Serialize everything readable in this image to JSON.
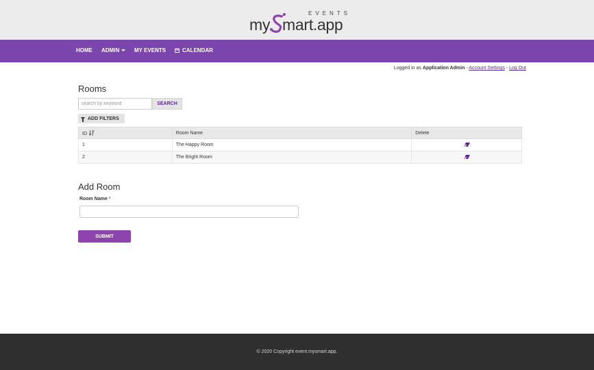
{
  "brand": {
    "logo_left": "my",
    "logo_right": "mart.app",
    "logo_sub": "EVENTS"
  },
  "nav": {
    "home": "HOME",
    "admin": "ADMIN",
    "my_events": "MY EVENTS",
    "calendar": "CALENDAR"
  },
  "user_bar": {
    "prefix": "Logged in as",
    "user": "Application Admin",
    "sep1": "-",
    "account": "Account Settings",
    "sep2": "-",
    "logout": "Log Out"
  },
  "rooms": {
    "title": "Rooms",
    "search_placeholder": "search by keyword",
    "search_label": "SEARCH",
    "filters_label": "ADD FILTERS",
    "columns": [
      "ID",
      "Room Name",
      "Delete"
    ],
    "rows": [
      {
        "id": "1",
        "name": "The Happy Room"
      },
      {
        "id": "2",
        "name": "The Bright Room"
      }
    ]
  },
  "add_room": {
    "title": "Add Room",
    "field_label": "Room Name",
    "required_mark": "*",
    "room_value": "",
    "submit_label": "SUBMIT"
  },
  "footer": {
    "copyright": "© 2020 Copyright event.mysmart.app."
  },
  "colors": {
    "nav_bg": "#7a45ac",
    "submit_bg": "#8e44ad",
    "link": "#5a2a8c",
    "footer_bg": "#2f2f2f",
    "topbar_bg": "#ececec"
  },
  "icons": {
    "sort": "sort-numeric-icon",
    "delete": "eraser-icon",
    "calendar": "calendar-icon",
    "filter": "filter-icon",
    "dropdown": "caret-down-icon"
  }
}
